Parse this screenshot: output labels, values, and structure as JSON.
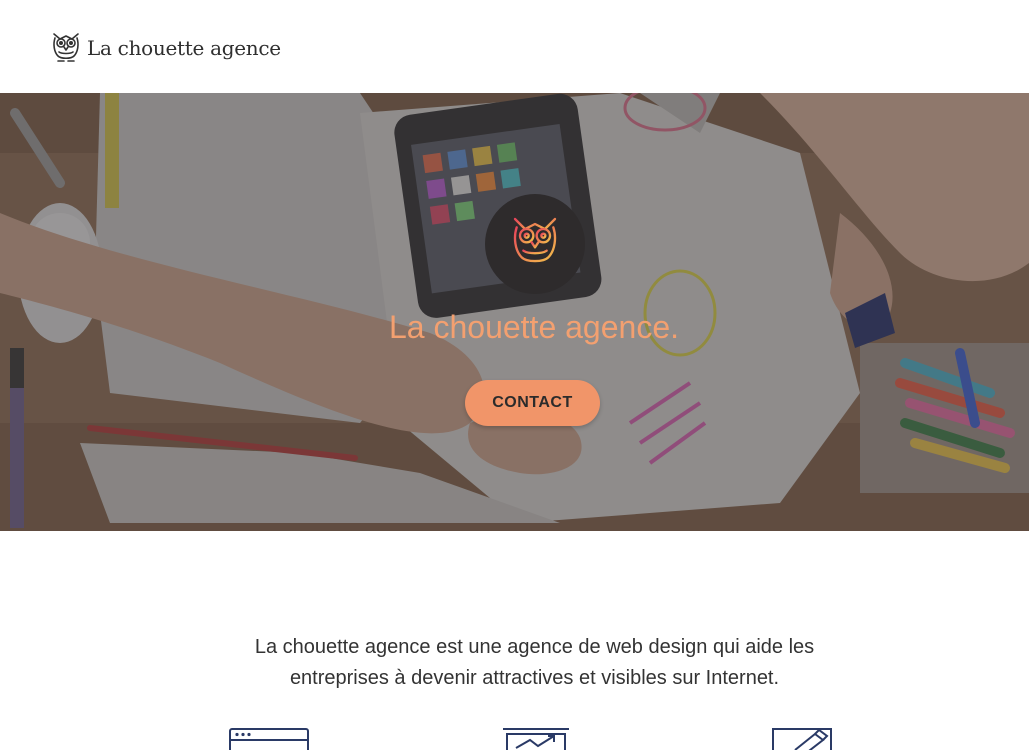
{
  "header": {
    "brand_name": "La chouette agence",
    "logo_icon": "owl-icon"
  },
  "hero": {
    "badge_icon": "owl-icon",
    "title": "La chouette agence.",
    "contact_label": "CONTACT",
    "title_color": "#f3a070",
    "button_color": "#f19569"
  },
  "intro": {
    "line1": "La chouette agence est une agence de web design qui aide les",
    "line2": "entreprises à devenir attractives et visibles sur Internet."
  },
  "features": {
    "icons": [
      "browser-window-icon",
      "growth-chart-icon",
      "design-pen-icon"
    ]
  }
}
